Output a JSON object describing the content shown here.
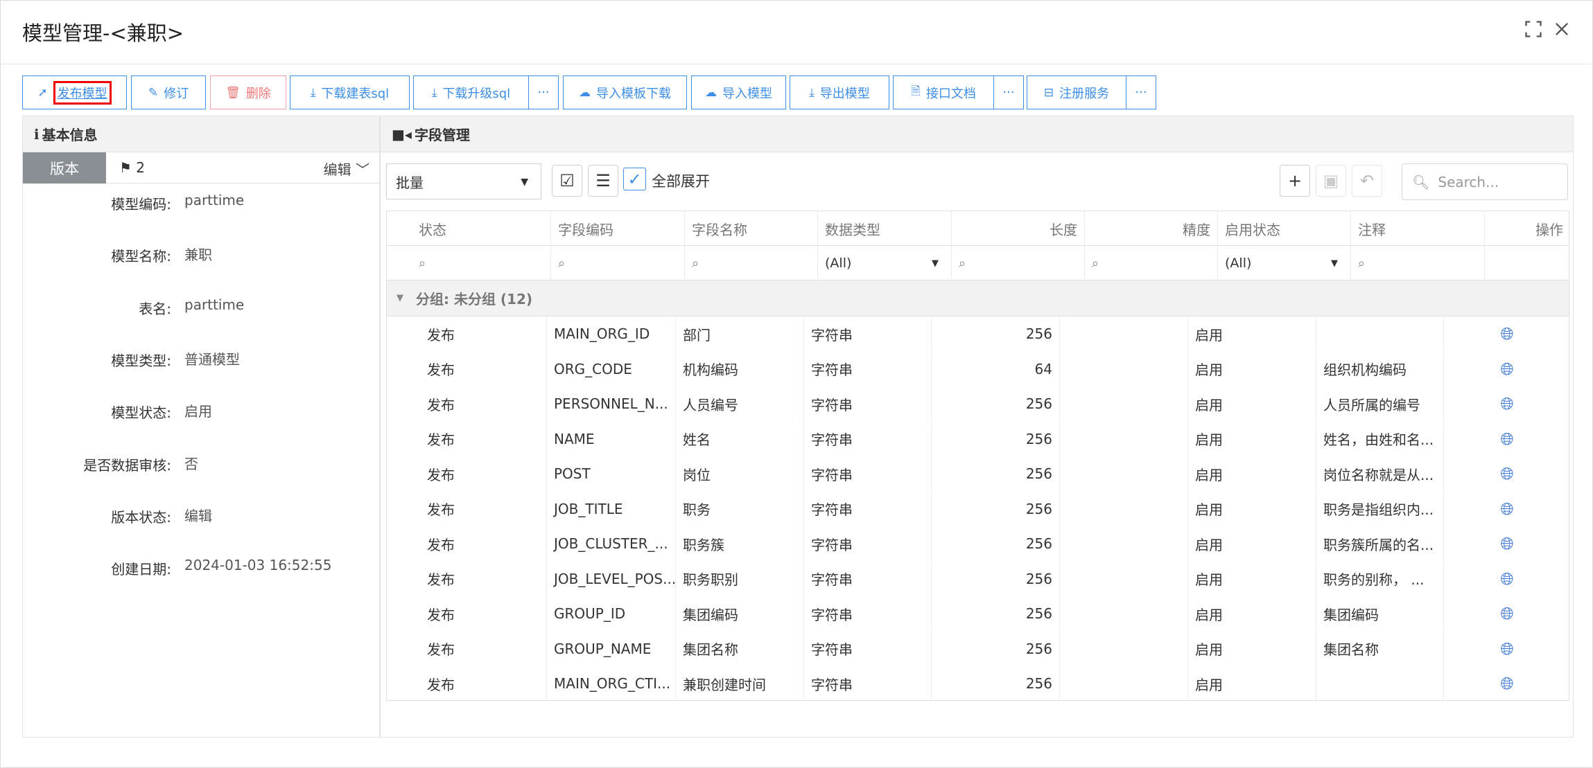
{
  "window": {
    "title": "模型管理-<兼职>"
  },
  "toolbar": {
    "buttons": [
      {
        "label": "发布模型",
        "icon": "send-icon"
      },
      {
        "label": "修订",
        "icon": "edit-icon"
      },
      {
        "label": "删除",
        "icon": "trash-icon"
      },
      {
        "label": "下载建表sql",
        "icon": "download-icon"
      },
      {
        "label": "下载升级sql",
        "icon": "download-icon"
      },
      {
        "label": "导入模板下载",
        "icon": "cloud-upload-icon"
      },
      {
        "label": "导入模型",
        "icon": "cloud-upload-icon"
      },
      {
        "label": "导出模型",
        "icon": "download-icon"
      },
      {
        "label": "接口文档",
        "icon": "document-icon"
      },
      {
        "label": "注册服务",
        "icon": "register-icon"
      }
    ],
    "more": "···"
  },
  "basic_info": {
    "title": "基本信息",
    "version_tab": "版本",
    "version_number": "2",
    "edit_label": "编辑",
    "fields": [
      {
        "label": "模型编码:",
        "value": "parttime"
      },
      {
        "label": "模型名称:",
        "value": "兼职"
      },
      {
        "label": "表名:",
        "value": "parttime"
      },
      {
        "label": "模型类型:",
        "value": "普通模型"
      },
      {
        "label": "模型状态:",
        "value": "启用"
      },
      {
        "label": "是否数据审核:",
        "value": "否"
      },
      {
        "label": "版本状态:",
        "value": "编辑"
      },
      {
        "label": "创建日期:",
        "value": "2024-01-03 16:52:55"
      }
    ]
  },
  "fields_panel": {
    "title": "字段管理",
    "batch_select": "批量",
    "expand_all_label": "全部展开",
    "search_placeholder": "Search...",
    "columns": [
      "状态",
      "字段编码",
      "字段名称",
      "数据类型",
      "长度",
      "精度",
      "启用状态",
      "注释",
      "操作"
    ],
    "filter_all": "(All)",
    "group_label": "分组: 未分组 (12)",
    "rows": [
      {
        "status": "发布",
        "code": "MAIN_ORG_ID",
        "name": "部门",
        "type": "字符串",
        "length": "256",
        "precision": "",
        "enabled": "启用",
        "comment": ""
      },
      {
        "status": "发布",
        "code": "ORG_CODE",
        "name": "机构编码",
        "type": "字符串",
        "length": "64",
        "precision": "",
        "enabled": "启用",
        "comment": "组织机构编码"
      },
      {
        "status": "发布",
        "code": "PERSONNEL_N...",
        "name": "人员编号",
        "type": "字符串",
        "length": "256",
        "precision": "",
        "enabled": "启用",
        "comment": "人员所属的编号"
      },
      {
        "status": "发布",
        "code": "NAME",
        "name": "姓名",
        "type": "字符串",
        "length": "256",
        "precision": "",
        "enabled": "启用",
        "comment": "姓名，由姓和名..."
      },
      {
        "status": "发布",
        "code": "POST",
        "name": "岗位",
        "type": "字符串",
        "length": "256",
        "precision": "",
        "enabled": "启用",
        "comment": "岗位名称就是从..."
      },
      {
        "status": "发布",
        "code": "JOB_TITLE",
        "name": "职务",
        "type": "字符串",
        "length": "256",
        "precision": "",
        "enabled": "启用",
        "comment": "职务是指组织内..."
      },
      {
        "status": "发布",
        "code": "JOB_CLUSTER_...",
        "name": "职务簇",
        "type": "字符串",
        "length": "256",
        "precision": "",
        "enabled": "启用",
        "comment": "职务簇所属的名..."
      },
      {
        "status": "发布",
        "code": "JOB_LEVEL_POS...",
        "name": "职务职别",
        "type": "字符串",
        "length": "256",
        "precision": "",
        "enabled": "启用",
        "comment": "职务的别称， ..."
      },
      {
        "status": "发布",
        "code": "GROUP_ID",
        "name": "集团编码",
        "type": "字符串",
        "length": "256",
        "precision": "",
        "enabled": "启用",
        "comment": "集团编码"
      },
      {
        "status": "发布",
        "code": "GROUP_NAME",
        "name": "集团名称",
        "type": "字符串",
        "length": "256",
        "precision": "",
        "enabled": "启用",
        "comment": "集团名称"
      },
      {
        "status": "发布",
        "code": "MAIN_ORG_CTI...",
        "name": "兼职创建时间",
        "type": "字符串",
        "length": "256",
        "precision": "",
        "enabled": "启用",
        "comment": ""
      }
    ]
  }
}
